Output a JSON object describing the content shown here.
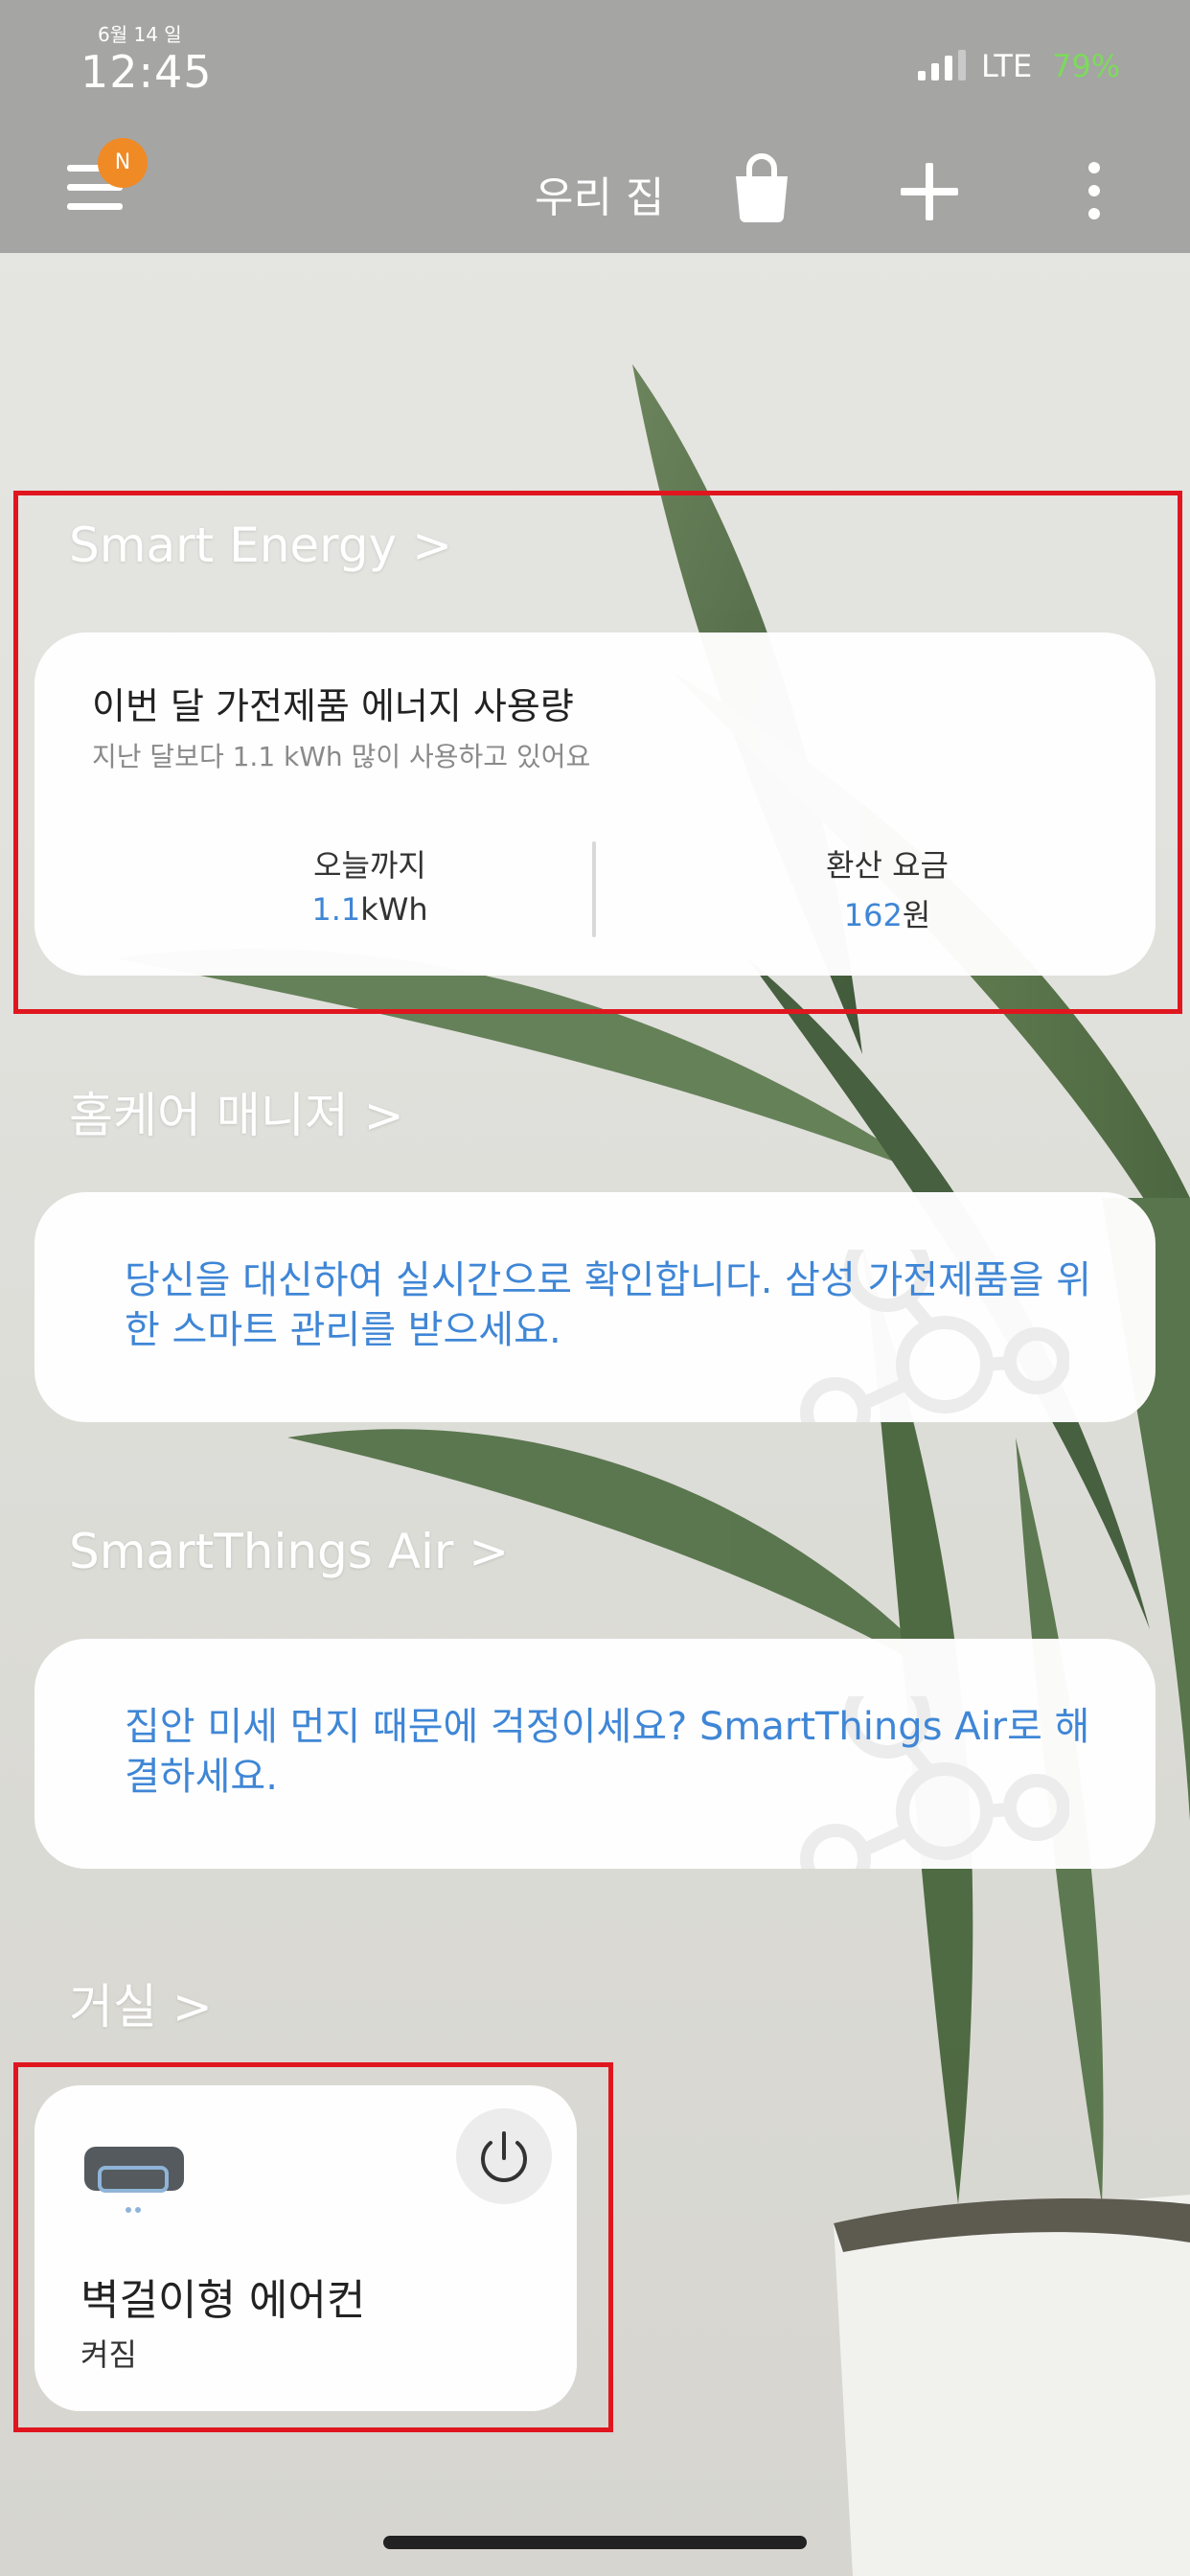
{
  "status_bar": {
    "date": "6월 14 일",
    "time": "12:45",
    "network": "LTE",
    "battery": "79%"
  },
  "app_bar": {
    "badge": "N",
    "home_name": "우리 집",
    "icons": [
      "menu-icon",
      "shopping-bag-icon",
      "plus-icon",
      "more-vertical-icon"
    ]
  },
  "smart_energy": {
    "title": "Smart Energy >",
    "card_title": "이번 달 가전제품 에너지 사용량",
    "card_subtitle": "지난 달보다 1.1 kWh 많이 사용하고 있어요",
    "today_label": "오늘까지",
    "today_value": "1.1",
    "today_unit": "kWh",
    "fee_label": "환산 요금",
    "fee_value": "162",
    "fee_unit": "원"
  },
  "home_care": {
    "title": "홈케어 매니저 >",
    "text": "당신을 대신하여 실시간으로 확인합니다. 삼성 가전제품을 위한 스마트 관리를 받으세요."
  },
  "air": {
    "title": "SmartThings Air >",
    "text": "집안 미세 먼지 때문에 걱정이세요? SmartThings Air로 해결하세요."
  },
  "living_room": {
    "title": "거실 >",
    "device": {
      "name": "벽걸이형 에어컨",
      "state": "켜짐",
      "icon": "air-conditioner-icon"
    }
  },
  "colors": {
    "accent_blue": "#3f86d6",
    "highlight_red": "#e0161f",
    "badge_orange": "#f08a24",
    "battery_green": "#7cdb5a"
  }
}
